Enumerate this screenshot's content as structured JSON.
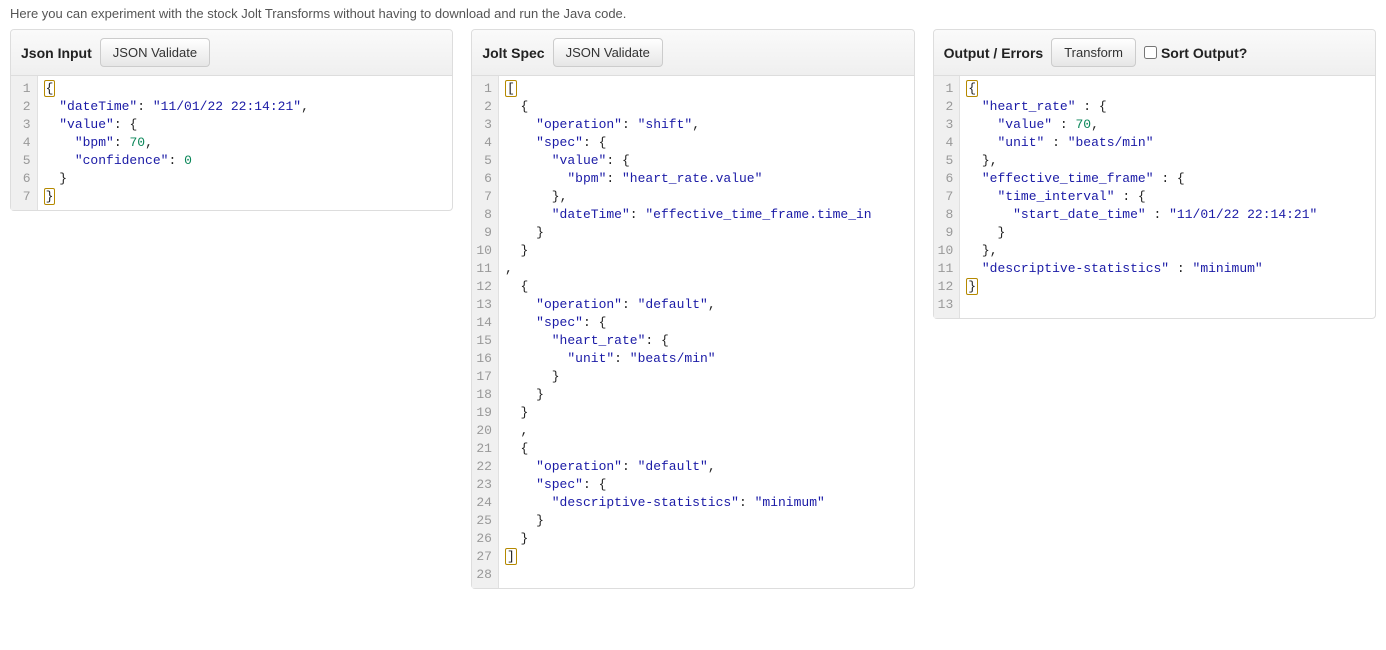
{
  "intro": "Here you can experiment with the stock Jolt Transforms without having to download and run the Java code.",
  "panels": {
    "input": {
      "title": "Json Input",
      "validate_label": "JSON Validate",
      "lines": [
        [
          {
            "t": "brace",
            "v": "{",
            "box": true
          }
        ],
        [
          {
            "t": "punct",
            "v": "  "
          },
          {
            "t": "key",
            "v": "\"dateTime\""
          },
          {
            "t": "punct",
            "v": ": "
          },
          {
            "t": "string",
            "v": "\"11/01/22 22:14:21\""
          },
          {
            "t": "punct",
            "v": ","
          }
        ],
        [
          {
            "t": "punct",
            "v": "  "
          },
          {
            "t": "key",
            "v": "\"value\""
          },
          {
            "t": "punct",
            "v": ": "
          },
          {
            "t": "brace",
            "v": "{"
          }
        ],
        [
          {
            "t": "punct",
            "v": "    "
          },
          {
            "t": "key",
            "v": "\"bpm\""
          },
          {
            "t": "punct",
            "v": ": "
          },
          {
            "t": "number",
            "v": "70"
          },
          {
            "t": "punct",
            "v": ","
          }
        ],
        [
          {
            "t": "punct",
            "v": "    "
          },
          {
            "t": "key",
            "v": "\"confidence\""
          },
          {
            "t": "punct",
            "v": ": "
          },
          {
            "t": "number",
            "v": "0"
          }
        ],
        [
          {
            "t": "punct",
            "v": "  "
          },
          {
            "t": "brace",
            "v": "}"
          }
        ],
        [
          {
            "t": "brace",
            "v": "}",
            "box": true
          }
        ]
      ]
    },
    "spec": {
      "title": "Jolt Spec",
      "validate_label": "JSON Validate",
      "lines": [
        [
          {
            "t": "brace",
            "v": "[",
            "box": true
          }
        ],
        [
          {
            "t": "punct",
            "v": "  "
          },
          {
            "t": "brace",
            "v": "{"
          }
        ],
        [
          {
            "t": "punct",
            "v": "    "
          },
          {
            "t": "key",
            "v": "\"operation\""
          },
          {
            "t": "punct",
            "v": ": "
          },
          {
            "t": "string",
            "v": "\"shift\""
          },
          {
            "t": "punct",
            "v": ","
          }
        ],
        [
          {
            "t": "punct",
            "v": "    "
          },
          {
            "t": "key",
            "v": "\"spec\""
          },
          {
            "t": "punct",
            "v": ": "
          },
          {
            "t": "brace",
            "v": "{"
          }
        ],
        [
          {
            "t": "punct",
            "v": "      "
          },
          {
            "t": "key",
            "v": "\"value\""
          },
          {
            "t": "punct",
            "v": ": "
          },
          {
            "t": "brace",
            "v": "{"
          }
        ],
        [
          {
            "t": "punct",
            "v": "        "
          },
          {
            "t": "key",
            "v": "\"bpm\""
          },
          {
            "t": "punct",
            "v": ": "
          },
          {
            "t": "string",
            "v": "\"heart_rate.value\""
          }
        ],
        [
          {
            "t": "punct",
            "v": "      "
          },
          {
            "t": "brace",
            "v": "}"
          },
          {
            "t": "punct",
            "v": ","
          }
        ],
        [
          {
            "t": "punct",
            "v": "      "
          },
          {
            "t": "key",
            "v": "\"dateTime\""
          },
          {
            "t": "punct",
            "v": ": "
          },
          {
            "t": "string",
            "v": "\"effective_time_frame.time_in"
          }
        ],
        [
          {
            "t": "punct",
            "v": "    "
          },
          {
            "t": "brace",
            "v": "}"
          }
        ],
        [
          {
            "t": "punct",
            "v": "  "
          },
          {
            "t": "brace",
            "v": "}"
          }
        ],
        [
          {
            "t": "punct",
            "v": ","
          }
        ],
        [
          {
            "t": "punct",
            "v": "  "
          },
          {
            "t": "brace",
            "v": "{"
          }
        ],
        [
          {
            "t": "punct",
            "v": "    "
          },
          {
            "t": "key",
            "v": "\"operation\""
          },
          {
            "t": "punct",
            "v": ": "
          },
          {
            "t": "string",
            "v": "\"default\""
          },
          {
            "t": "punct",
            "v": ","
          }
        ],
        [
          {
            "t": "punct",
            "v": "    "
          },
          {
            "t": "key",
            "v": "\"spec\""
          },
          {
            "t": "punct",
            "v": ": "
          },
          {
            "t": "brace",
            "v": "{"
          }
        ],
        [
          {
            "t": "punct",
            "v": "      "
          },
          {
            "t": "key",
            "v": "\"heart_rate\""
          },
          {
            "t": "punct",
            "v": ": "
          },
          {
            "t": "brace",
            "v": "{"
          }
        ],
        [
          {
            "t": "punct",
            "v": "        "
          },
          {
            "t": "key",
            "v": "\"unit\""
          },
          {
            "t": "punct",
            "v": ": "
          },
          {
            "t": "string",
            "v": "\"beats/min\""
          }
        ],
        [
          {
            "t": "punct",
            "v": "      "
          },
          {
            "t": "brace",
            "v": "}"
          }
        ],
        [
          {
            "t": "punct",
            "v": "    "
          },
          {
            "t": "brace",
            "v": "}"
          }
        ],
        [
          {
            "t": "punct",
            "v": "  "
          },
          {
            "t": "brace",
            "v": "}"
          }
        ],
        [
          {
            "t": "punct",
            "v": "  ,"
          }
        ],
        [
          {
            "t": "punct",
            "v": "  "
          },
          {
            "t": "brace",
            "v": "{"
          }
        ],
        [
          {
            "t": "punct",
            "v": "    "
          },
          {
            "t": "key",
            "v": "\"operation\""
          },
          {
            "t": "punct",
            "v": ": "
          },
          {
            "t": "string",
            "v": "\"default\""
          },
          {
            "t": "punct",
            "v": ","
          }
        ],
        [
          {
            "t": "punct",
            "v": "    "
          },
          {
            "t": "key",
            "v": "\"spec\""
          },
          {
            "t": "punct",
            "v": ": "
          },
          {
            "t": "brace",
            "v": "{"
          }
        ],
        [
          {
            "t": "punct",
            "v": "      "
          },
          {
            "t": "key",
            "v": "\"descriptive-statistics\""
          },
          {
            "t": "punct",
            "v": ": "
          },
          {
            "t": "string",
            "v": "\"minimum\""
          }
        ],
        [
          {
            "t": "punct",
            "v": "    "
          },
          {
            "t": "brace",
            "v": "}"
          }
        ],
        [
          {
            "t": "punct",
            "v": "  "
          },
          {
            "t": "brace",
            "v": "}"
          }
        ],
        [
          {
            "t": "brace",
            "v": "]",
            "box": true
          }
        ],
        []
      ]
    },
    "output": {
      "title": "Output / Errors",
      "transform_label": "Transform",
      "sort_label": "Sort Output?",
      "lines": [
        [
          {
            "t": "brace",
            "v": "{",
            "box": true
          }
        ],
        [
          {
            "t": "punct",
            "v": "  "
          },
          {
            "t": "key",
            "v": "\"heart_rate\""
          },
          {
            "t": "punct",
            "v": " : "
          },
          {
            "t": "brace",
            "v": "{"
          }
        ],
        [
          {
            "t": "punct",
            "v": "    "
          },
          {
            "t": "key",
            "v": "\"value\""
          },
          {
            "t": "punct",
            "v": " : "
          },
          {
            "t": "number",
            "v": "70"
          },
          {
            "t": "punct",
            "v": ","
          }
        ],
        [
          {
            "t": "punct",
            "v": "    "
          },
          {
            "t": "key",
            "v": "\"unit\""
          },
          {
            "t": "punct",
            "v": " : "
          },
          {
            "t": "string",
            "v": "\"beats/min\""
          }
        ],
        [
          {
            "t": "punct",
            "v": "  "
          },
          {
            "t": "brace",
            "v": "}"
          },
          {
            "t": "punct",
            "v": ","
          }
        ],
        [
          {
            "t": "punct",
            "v": "  "
          },
          {
            "t": "key",
            "v": "\"effective_time_frame\""
          },
          {
            "t": "punct",
            "v": " : "
          },
          {
            "t": "brace",
            "v": "{"
          }
        ],
        [
          {
            "t": "punct",
            "v": "    "
          },
          {
            "t": "key",
            "v": "\"time_interval\""
          },
          {
            "t": "punct",
            "v": " : "
          },
          {
            "t": "brace",
            "v": "{"
          }
        ],
        [
          {
            "t": "punct",
            "v": "      "
          },
          {
            "t": "key",
            "v": "\"start_date_time\""
          },
          {
            "t": "punct",
            "v": " : "
          },
          {
            "t": "string",
            "v": "\"11/01/22 22:14:21\""
          }
        ],
        [
          {
            "t": "punct",
            "v": "    "
          },
          {
            "t": "brace",
            "v": "}"
          }
        ],
        [
          {
            "t": "punct",
            "v": "  "
          },
          {
            "t": "brace",
            "v": "}"
          },
          {
            "t": "punct",
            "v": ","
          }
        ],
        [
          {
            "t": "punct",
            "v": "  "
          },
          {
            "t": "key",
            "v": "\"descriptive-statistics\""
          },
          {
            "t": "punct",
            "v": " : "
          },
          {
            "t": "string",
            "v": "\"minimum\""
          }
        ],
        [
          {
            "t": "brace",
            "v": "}",
            "box": true
          }
        ],
        []
      ]
    }
  }
}
